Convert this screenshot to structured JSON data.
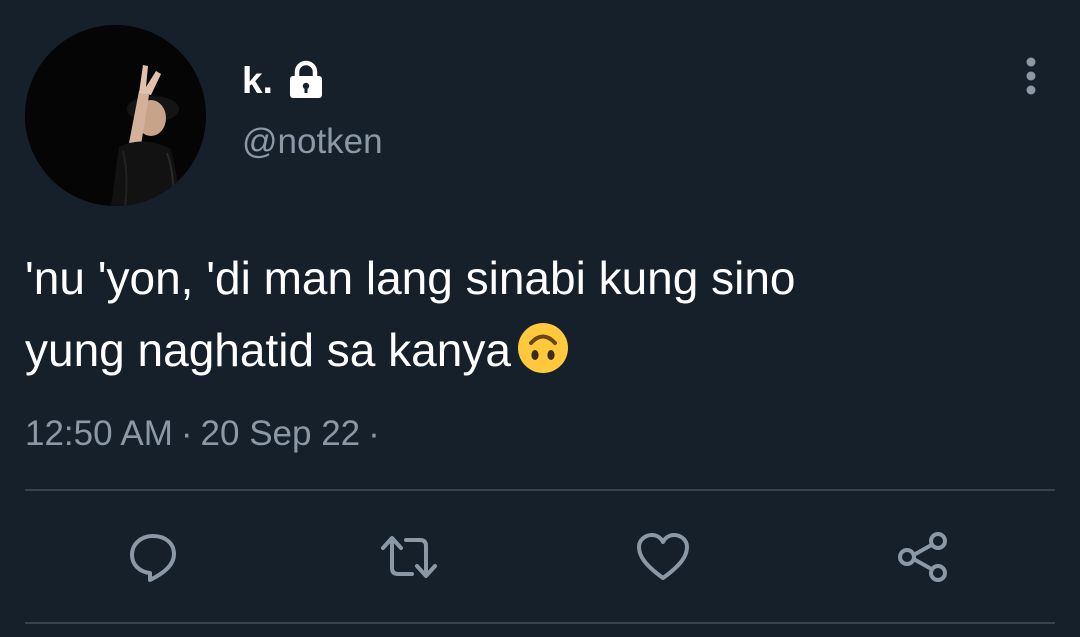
{
  "tweet": {
    "author": {
      "display_name": "k.",
      "handle": "@notken",
      "protected": true,
      "avatar": "avatar-photo"
    },
    "text_lines": [
      "'nu 'yon, 'di man lang sinabi kung sino",
      "yung naghatid sa kanya"
    ],
    "emoji": "upside-down-face-emoji",
    "time": "12:50 AM",
    "date": "20 Sep 22",
    "separator": "·",
    "trailing_separator": "·"
  },
  "actions": [
    "reply",
    "retweet",
    "like",
    "share"
  ],
  "icons": {
    "lock": "lock-icon",
    "more": "more-vertical-icon",
    "reply": "reply-icon",
    "retweet": "retweet-icon",
    "like": "heart-icon",
    "share": "share-icon"
  },
  "colors": {
    "background": "#15202b",
    "text": "#ffffff",
    "secondary_text": "#8b98a5",
    "divider": "#38444d",
    "emoji": "#ffc83d"
  }
}
